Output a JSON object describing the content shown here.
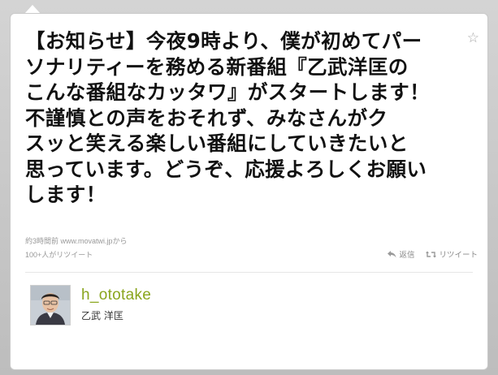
{
  "tweet": {
    "text": "【お知らせ】今夜9時より、僕が初めてパー\nソナリティーを務める新番組『乙武洋匡の\nこんな番組なカッタワ』がスタートします！\n不謹慎との声をおそれず、みなさんがク\nスッと笑える楽しい番組にしていきたいと\n思っています。どうぞ、応援よろしくお願い\nします！",
    "timestamp": "約3時間前",
    "source": "www.movatwi.jp",
    "source_suffix": "から",
    "retweet_count": "100+人がリツイート"
  },
  "actions": {
    "reply_label": "返信",
    "retweet_label": "リツイート"
  },
  "author": {
    "username": "h_ototake",
    "display_name": "乙武 洋匡"
  },
  "colors": {
    "username": "#8aa61f",
    "background": "#c8c8c8"
  },
  "icons": {
    "favorite": "star-icon",
    "reply": "reply-arrow-icon",
    "retweet": "retweet-arrows-icon"
  }
}
